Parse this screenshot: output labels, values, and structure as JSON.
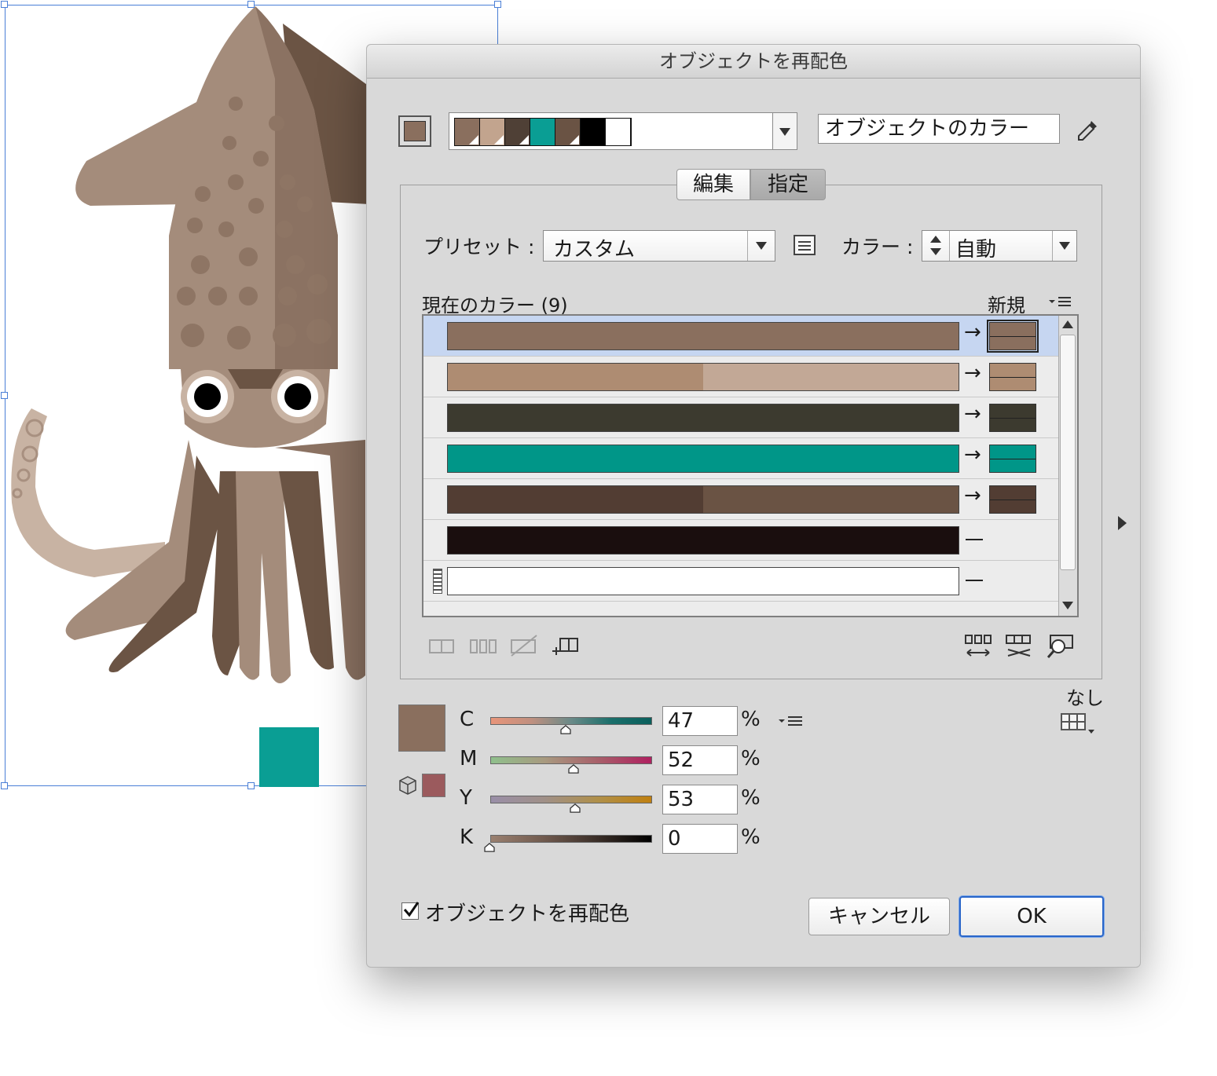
{
  "dialog": {
    "title": "オブジェクトを再配色",
    "color_group_field": "オブジェクトのカラー",
    "group_swatches": [
      "#8a6f5e",
      "#c2a48e",
      "#4f4036",
      "#0a9e94",
      "#6a5344",
      "#000000",
      "#ffffff"
    ],
    "tabs": [
      {
        "label": "編集",
        "active": false
      },
      {
        "label": "指定",
        "active": true
      }
    ],
    "preset_label": "プリセット :",
    "preset_value": "カスタム",
    "colors_label": "カラー :",
    "colors_value": "自動",
    "current_colors_label": "現在のカラー (9)",
    "new_label": "新規",
    "arrow_symbol": "→",
    "rows": [
      {
        "current": [
          "#8a6f5e"
        ],
        "new": "#8a6f5e",
        "mapped": true,
        "selected": true
      },
      {
        "current": [
          "#ae8c72",
          "#c2a896"
        ],
        "new": "#ae8c72",
        "mapped": true,
        "selected": false
      },
      {
        "current": [
          "#3c3a2f"
        ],
        "new": "#3c3a2f",
        "mapped": true,
        "selected": false
      },
      {
        "current": [
          "#009688"
        ],
        "new": "#009688",
        "mapped": true,
        "selected": false
      },
      {
        "current": [
          "#523d33",
          "#6a5344"
        ],
        "new": "#523d33",
        "mapped": true,
        "selected": false
      },
      {
        "current": [
          "#1a0e0e"
        ],
        "new": "",
        "mapped": false,
        "selected": false
      },
      {
        "current": [
          "#ffffff"
        ],
        "new": "",
        "mapped": false,
        "selected": false
      }
    ],
    "none_label": "なし",
    "fill_color": "#8a6f5e",
    "out_of_gamut_color": "#9b5a5d",
    "cmyk": [
      {
        "channel": "C",
        "value": "47",
        "fraction": 0.47,
        "gradient": "linear-gradient(90deg,#e8957a,#c09080,#6a8a88,#1b6f6b,#0a5f5c)"
      },
      {
        "channel": "M",
        "value": "52",
        "fraction": 0.52,
        "gradient": "linear-gradient(90deg,#8fc08c,#a89a80,#a8606a,#b02060)"
      },
      {
        "channel": "Y",
        "value": "53",
        "fraction": 0.53,
        "gradient": "linear-gradient(90deg,#9a8fa8,#a09088,#b0904a,#c08010)"
      },
      {
        "channel": "K",
        "value": "0",
        "fraction": 0.0,
        "gradient": "linear-gradient(90deg,#9a8070,#705a4e,#3a2e28,#000000)"
      }
    ],
    "percent_sign": "%",
    "recolor_checkbox_label": "オブジェクトを再配色",
    "recolor_checked": true,
    "cancel_label": "キャンセル",
    "ok_label": "OK"
  },
  "artwork": {
    "body_color": "#a48c7b",
    "dark_color": "#6b5444",
    "light_color": "#c8b3a3",
    "teal_color": "#0a9e94"
  }
}
